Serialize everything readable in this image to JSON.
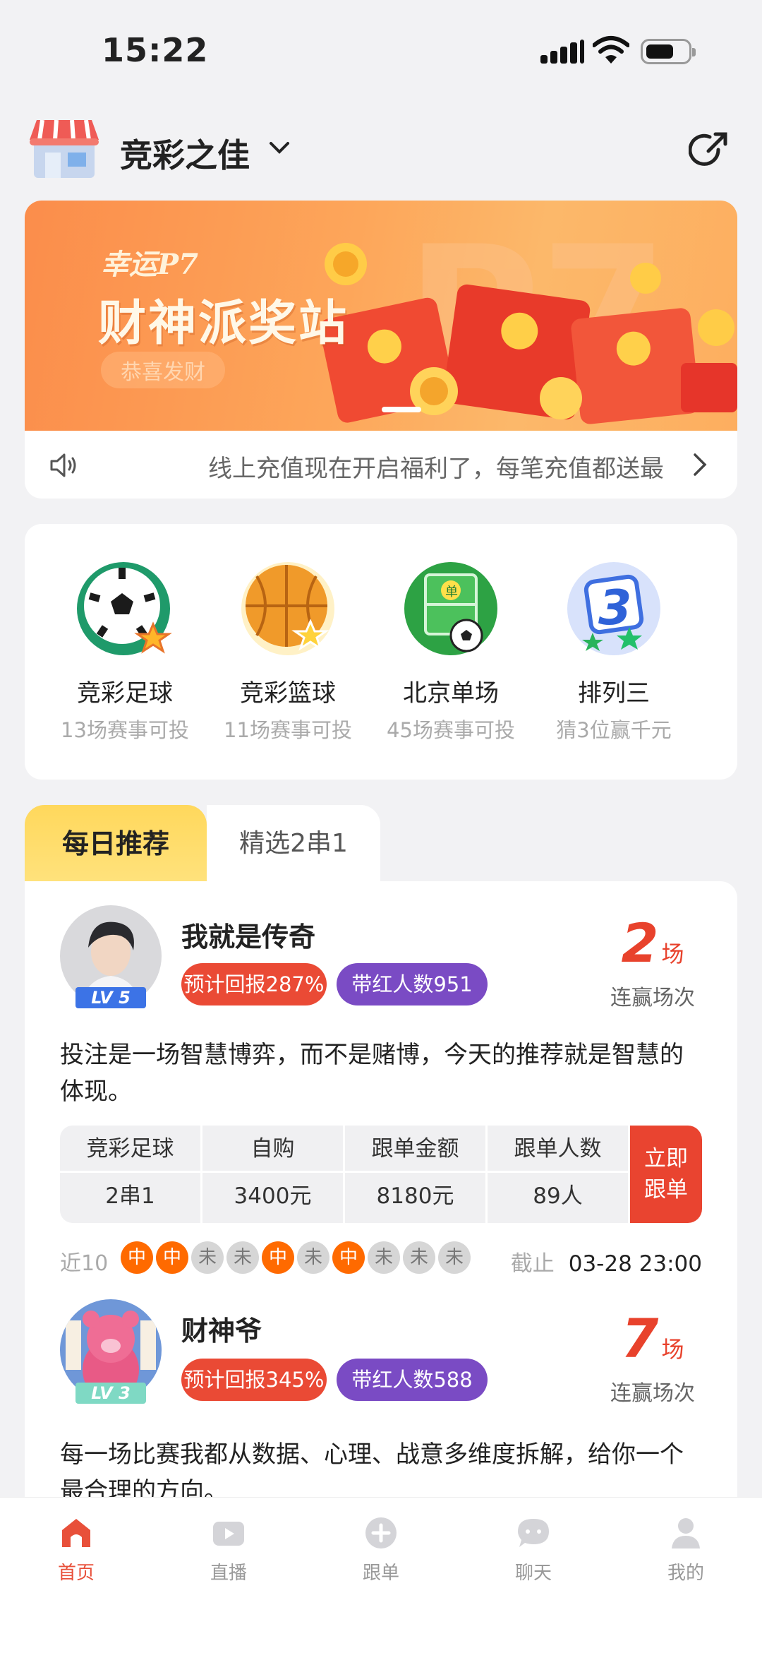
{
  "status_bar": {
    "time": "15:22"
  },
  "header": {
    "store_name": "竞彩之佳"
  },
  "banner": {
    "subtitle": "幸运P7",
    "title": "财神派奖站",
    "tag": "恭喜发财",
    "notice": "线上充值现在开启福利了，每笔充值都送最"
  },
  "categories": [
    {
      "name": "竞彩足球",
      "sub": "13场赛事可投",
      "icon": "soccer-ball-icon"
    },
    {
      "name": "竞彩篮球",
      "sub": "11场赛事可投",
      "icon": "basketball-icon"
    },
    {
      "name": "北京单场",
      "sub": "45场赛事可投",
      "icon": "football-field-icon"
    },
    {
      "name": "排列三",
      "sub": "猜3位赢千元",
      "icon": "number-three-icon"
    }
  ],
  "tabs": {
    "active": "每日推荐",
    "inactive": "精选2串1"
  },
  "recommendations": [
    {
      "user": "我就是传奇",
      "level": "LV 5",
      "return_badge": "预计回报287%",
      "hit_badge": "带红人数951",
      "streak": "2",
      "streak_unit": "场",
      "streak_label": "连赢场次",
      "description": "投注是一场智慧博弈，而不是赌博，今天的推荐就是智慧的体现。",
      "table": {
        "headers": [
          "竞彩足球",
          "自购",
          "跟单金额",
          "跟单人数"
        ],
        "values": [
          "2串1",
          "3400元",
          "8180元",
          "89人"
        ]
      },
      "follow_button": [
        "立即",
        "跟单"
      ],
      "history_label": "近10",
      "history": [
        "中",
        "中",
        "未",
        "未",
        "中",
        "未",
        "中",
        "未",
        "未",
        "未"
      ],
      "deadline_label": "截止",
      "deadline": "03-28 23:00"
    },
    {
      "user": "财神爷",
      "level": "LV 3",
      "return_badge": "预计回报345%",
      "hit_badge": "带红人数588",
      "streak": "7",
      "streak_unit": "场",
      "streak_label": "连赢场次",
      "description": "每一场比赛我都从数据、心理、战意多维度拆解，给你一个最合理的方向。"
    }
  ],
  "nav": [
    {
      "label": "首页",
      "icon": "home-icon",
      "active": true
    },
    {
      "label": "直播",
      "icon": "video-play-icon",
      "active": false
    },
    {
      "label": "跟单",
      "icon": "plus-circle-icon",
      "active": false
    },
    {
      "label": "聊天",
      "icon": "chat-bubble-icon",
      "active": false
    },
    {
      "label": "我的",
      "icon": "user-icon",
      "active": false
    }
  ],
  "colors": {
    "accent_red": "#e8422c",
    "purple": "#7a4bc4",
    "win_orange": "#ff6a00",
    "tab_yellow": "#ffd85c"
  }
}
